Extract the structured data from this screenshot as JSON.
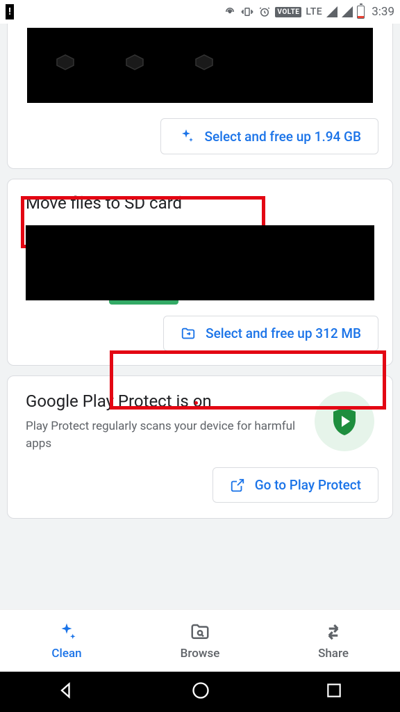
{
  "status": {
    "time": "3:39",
    "lte_label": "LTE",
    "volte_label": "VOLTE"
  },
  "card_top": {
    "action_label": "Select and free up 1.94 GB"
  },
  "card_move": {
    "title": "Move files to SD card",
    "action_label": "Select and free up 312 MB"
  },
  "card_protect": {
    "title": "Google Play Protect is on",
    "desc": "Play Protect regularly scans your device for harmful apps",
    "action_label": "Go to Play Protect"
  },
  "nav": {
    "clean": "Clean",
    "browse": "Browse",
    "share": "Share"
  }
}
